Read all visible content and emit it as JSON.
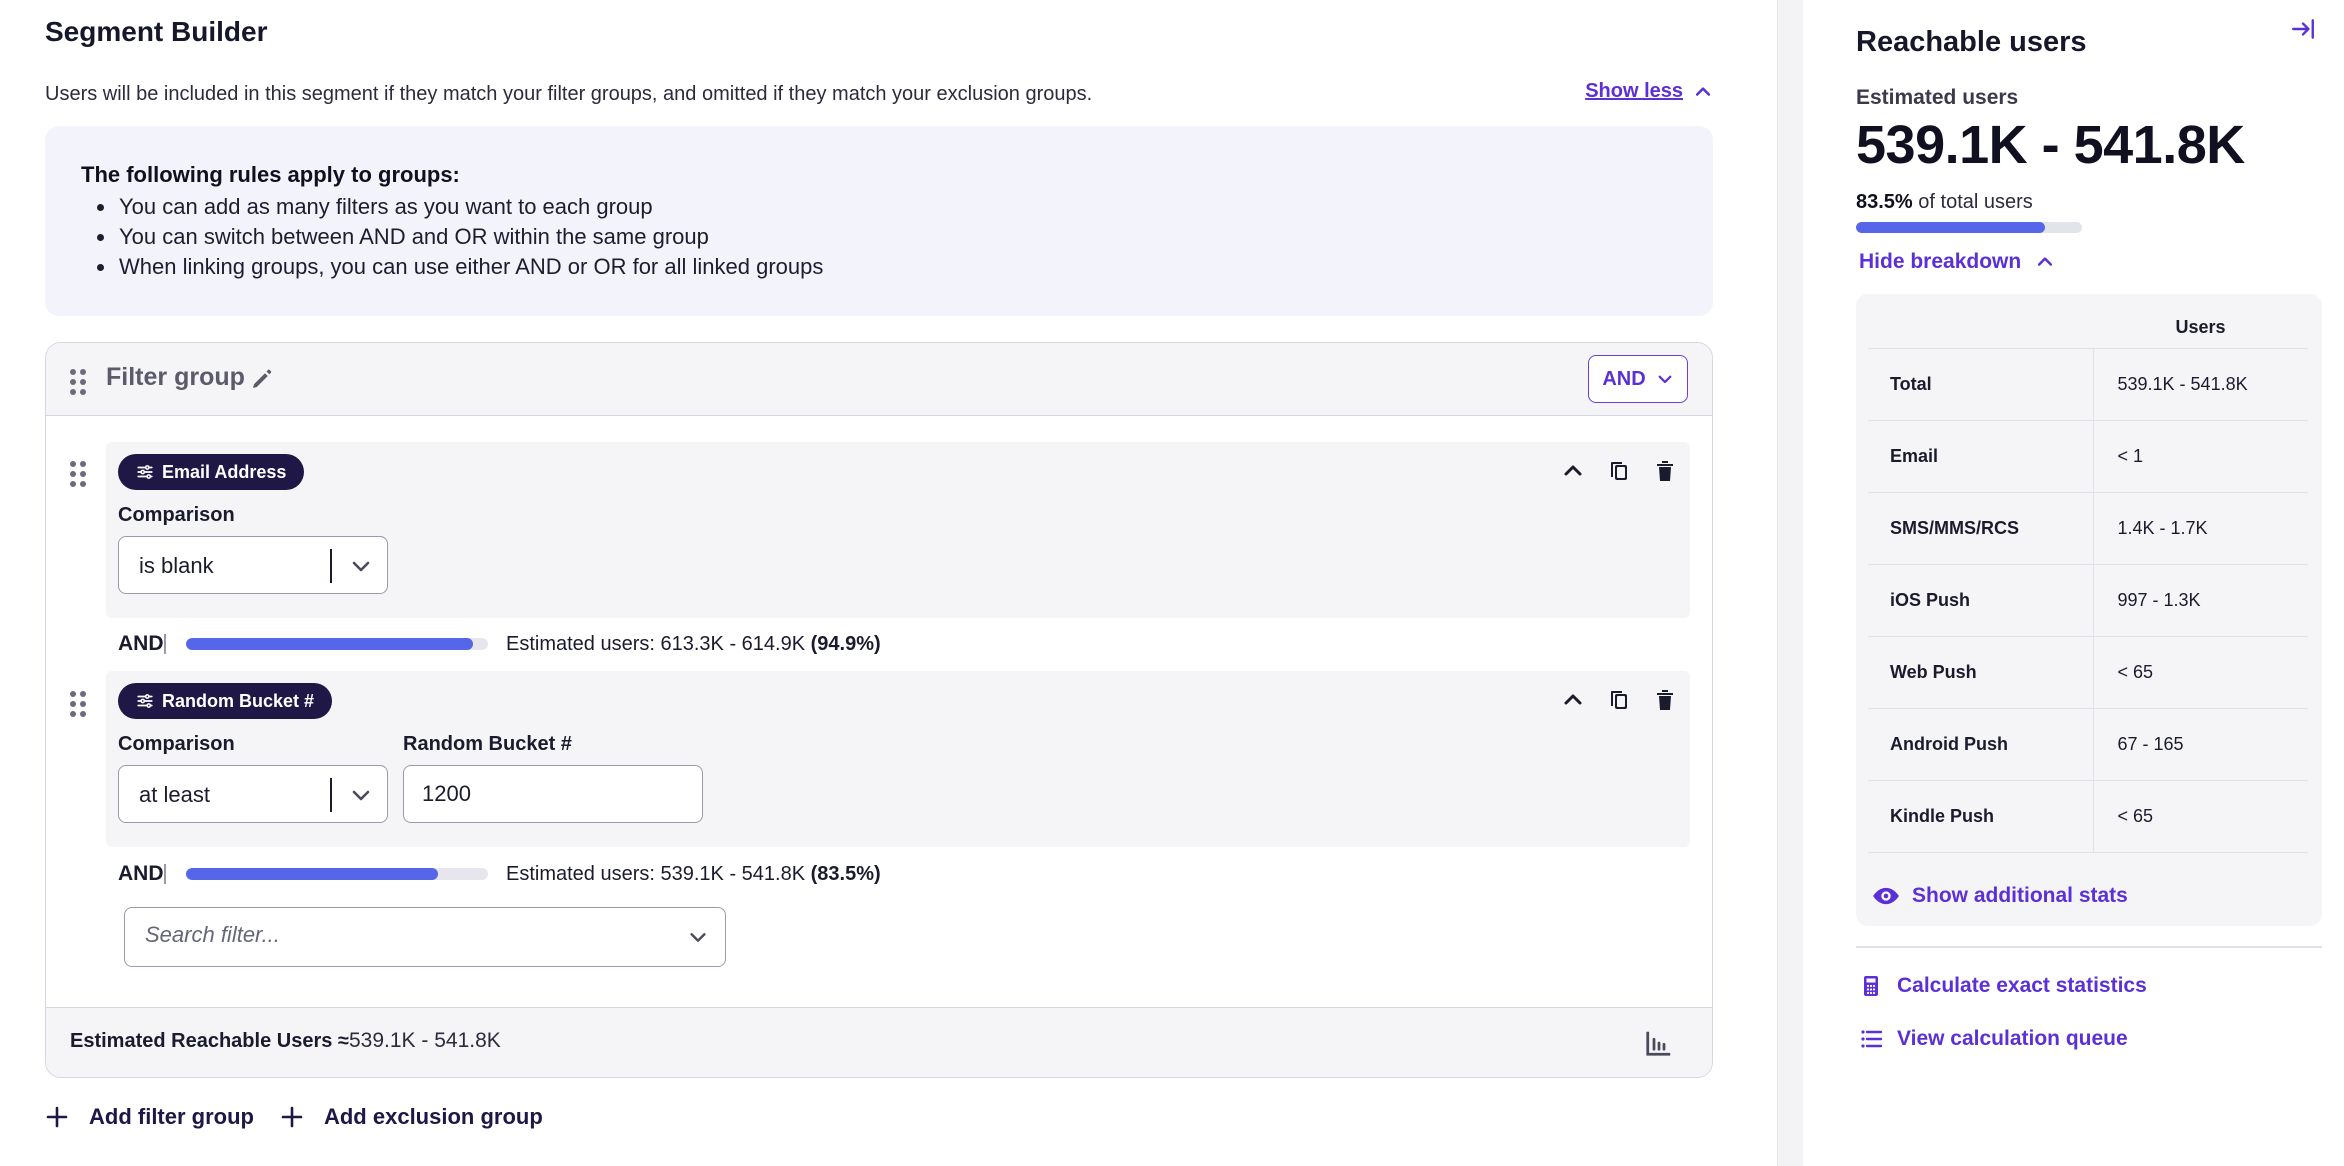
{
  "header": {
    "title": "Segment Builder",
    "subtitle": "Users will be included in this segment if they match your filter groups, and omitted if they match your exclusion groups.",
    "show_less": "Show less"
  },
  "rules": {
    "title": "The following rules apply to groups:",
    "items": [
      "You can add as many filters as you want to each group",
      "You can switch between AND and OR within the same group",
      "When linking groups, you can use either AND or OR for all linked groups"
    ]
  },
  "filter_group": {
    "title": "Filter group",
    "operator": "AND",
    "filters": [
      {
        "pill": "Email Address",
        "comparison_label": "Comparison",
        "comparison_value": "is blank"
      },
      {
        "pill": "Random Bucket #",
        "comparison_label": "Comparison",
        "comparison_value": "at least",
        "value_label": "Random Bucket #",
        "value": "1200"
      }
    ],
    "steps": [
      {
        "and": "AND",
        "progress": 0.949,
        "est_prefix": "Estimated users: 613.3K - 614.9K",
        "est_pct": "(94.9%)"
      },
      {
        "and": "AND",
        "progress": 0.835,
        "est_prefix": "Estimated users: 539.1K - 541.8K",
        "est_pct": "(83.5%)"
      }
    ],
    "search_placeholder": "Search filter...",
    "footer_label": "Estimated Reachable Users ≈",
    "footer_value": "539.1K - 541.8K"
  },
  "actions": {
    "add_filter_group": "Add filter group",
    "add_exclusion_group": "Add exclusion group"
  },
  "side": {
    "title": "Reachable users",
    "est_label": "Estimated users",
    "est_value": "539.1K - 541.8K",
    "pct_bold": "83.5%",
    "pct_text": " of total users",
    "progress": 0.835,
    "hide_breakdown": "Hide breakdown",
    "table_header": "Users",
    "rows": [
      {
        "k": "Total",
        "v": "539.1K - 541.8K"
      },
      {
        "k": "Email",
        "v": "< 1"
      },
      {
        "k": "SMS/MMS/RCS",
        "v": "1.4K - 1.7K"
      },
      {
        "k": "iOS Push",
        "v": "997 - 1.3K"
      },
      {
        "k": "Web Push",
        "v": "< 65"
      },
      {
        "k": "Android Push",
        "v": "67 - 165"
      },
      {
        "k": "Kindle Push",
        "v": "< 65"
      }
    ],
    "show_additional": "Show additional stats",
    "calculate_exact": "Calculate exact statistics",
    "view_queue": "View calculation queue"
  },
  "colors": {
    "accent": "#5b30d6",
    "progress": "#5566e8",
    "pill": "#1f1746"
  }
}
